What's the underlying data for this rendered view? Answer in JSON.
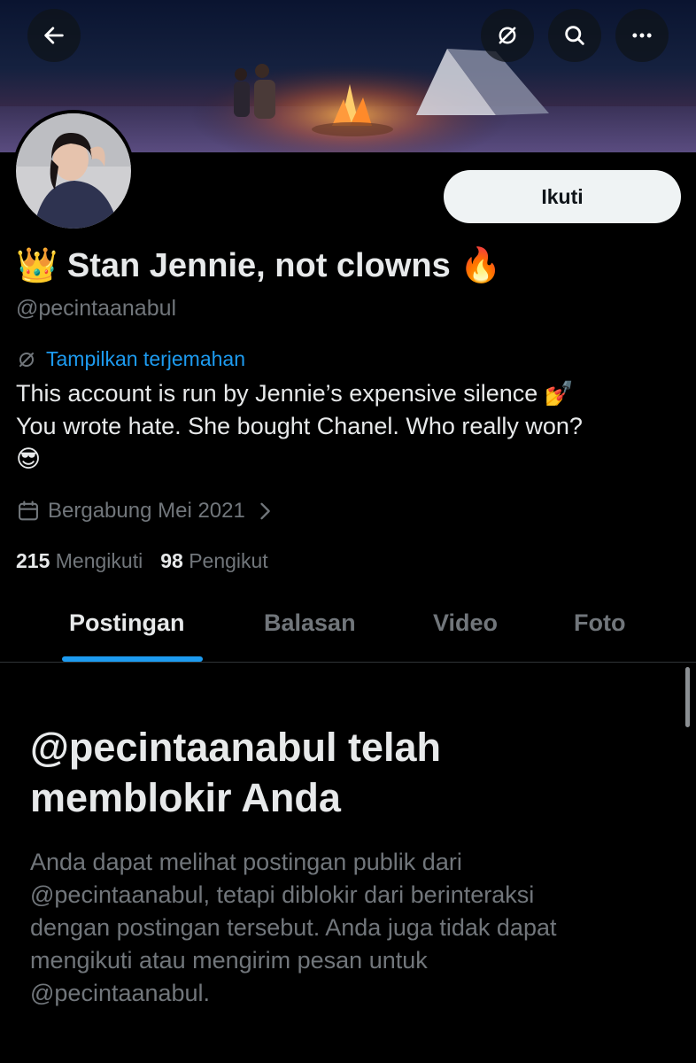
{
  "header": {
    "back_icon": "arrow-left-icon",
    "translate_icon": "translate-slash-icon",
    "search_icon": "search-icon",
    "more_icon": "more-horizontal-icon"
  },
  "profile": {
    "display_name": "👑 Stan Jennie, not clowns 🔥",
    "handle": "@pecintaanabul",
    "follow_label": "Ikuti",
    "translate_label": "Tampilkan terjemahan",
    "bio_lines": [
      "This account is run by Jennie’s expensive silence 💅",
      "You wrote hate. She bought Chanel. Who really won?",
      "😎"
    ],
    "joined": "Bergabung Mei 2021",
    "following_count": "215",
    "following_label": "Mengikuti",
    "followers_count": "98",
    "followers_label": "Pengikut"
  },
  "tabs": [
    "Postingan",
    "Balasan",
    "Video",
    "Foto"
  ],
  "blocked": {
    "title_lines": [
      "@pecintaanabul telah",
      "memblokir Anda"
    ],
    "desc_lines": [
      "Anda dapat melihat postingan publik dari",
      "@pecintaanabul, tetapi diblokir dari berinteraksi",
      "dengan postingan tersebut. Anda juga tidak dapat",
      "mengikuti atau mengirim pesan untuk",
      "@pecintaanabul."
    ]
  },
  "colors": {
    "accent": "#1d9bf0",
    "text_primary": "#e7e9ea",
    "text_secondary": "#71767b",
    "background": "#000000"
  }
}
